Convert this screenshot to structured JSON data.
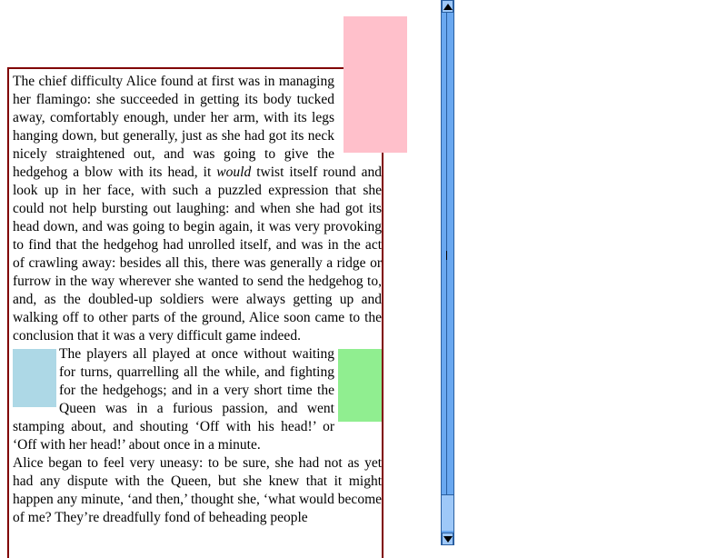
{
  "colors": {
    "border": "#800000",
    "pink_block": "#ffc0cb",
    "blue_block": "#add8e6",
    "green_block": "#90ee90",
    "scrollbar": "#6aa8f0"
  },
  "article": {
    "p1_before": "The chief difficulty Alice found at first was in managing her flamingo: she succeeded in getting its body tucked away, comfortably enough, under her arm, with its legs hanging down, but generally, just as she had got its neck nicely straightened out, and was going to give the hedgehog a blow with its head, it ",
    "p1_em": "would",
    "p1_after": " twist itself round and look up in her face, with such a puzzled expression that she could not help bursting out laughing: and when she had got its head down, and was going to begin again, it was very provoking to find that the hedgehog had unrolled itself, and was in the act of crawling away: besides all this, there was generally a ridge or furrow in the way wherever she wanted to send the hedgehog to, and, as the doubled-up soldiers were always getting up and walking off to other parts of the ground, Alice soon came to the conclusion that it was a very difficult game indeed.",
    "p2": "The players all played at once without waiting for turns, quarrelling all the while, and fighting for the hedgehogs; and in a very short time the Queen was in a furious passion, and went stamping about, and shouting ‘Off with his head!’ or ‘Off with her head!’ about once in a minute.",
    "p3": "Alice began to feel very uneasy: to be sure, she had not as yet had any dispute with the Queen, but she knew that it might happen any minute, ‘and then,’ thought she, ‘what would become of me? They’re dreadfully fond of beheading people"
  },
  "scrollbar": {
    "up_icon": "arrow-up-icon",
    "down_icon": "arrow-down-icon"
  }
}
